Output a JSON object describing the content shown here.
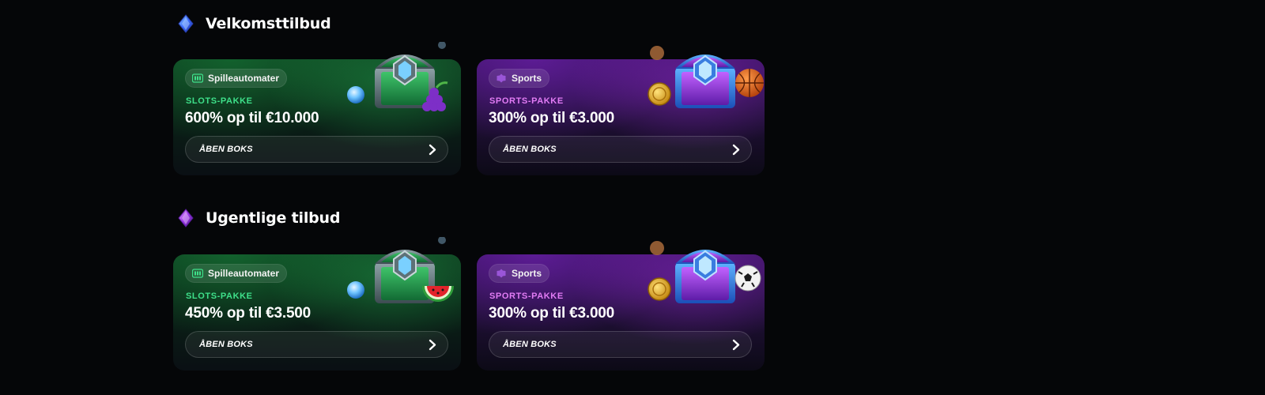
{
  "sections": [
    {
      "title": "Velkomsttilbud",
      "icon": "blue-gem-icon",
      "cards": [
        {
          "category": "Spilleautomater",
          "category_icon": "slot-machine-icon",
          "pack": "SLOTS-PAKKE",
          "offer": "600% op til €10.000",
          "button": "ÅBEN BOKS",
          "theme": "slots"
        },
        {
          "category": "Sports",
          "category_icon": "sports-icon",
          "pack": "SPORTS-PAKKE",
          "offer": "300% op til €3.000",
          "button": "ÅBEN BOKS",
          "theme": "sports"
        }
      ]
    },
    {
      "title": "Ugentlige tilbud",
      "icon": "purple-gem-icon",
      "cards": [
        {
          "category": "Spilleautomater",
          "category_icon": "slot-machine-icon",
          "pack": "SLOTS-PAKKE",
          "offer": "450% op til €3.500",
          "button": "ÅBEN BOKS",
          "theme": "slots"
        },
        {
          "category": "Sports",
          "category_icon": "sports-icon",
          "pack": "SPORTS-PAKKE",
          "offer": "300% op til €3.000",
          "button": "ÅBEN BOKS",
          "theme": "sports"
        }
      ]
    }
  ],
  "colors": {
    "background": "#050608",
    "slots_accent": "#3ee08a",
    "sports_accent": "#e27cf5"
  }
}
